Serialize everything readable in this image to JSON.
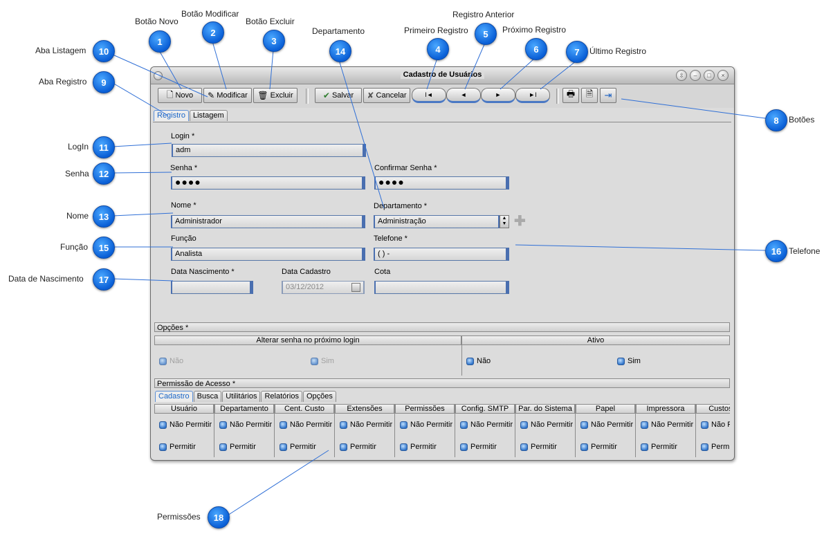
{
  "window": {
    "title": "Cadastro de Usuários"
  },
  "toolbar": {
    "novo": "Novo",
    "modificar": "Modificar",
    "excluir": "Excluir",
    "salvar": "Salvar",
    "cancelar": "Cancelar",
    "nav_first": "I◄",
    "nav_prev": "◄",
    "nav_next": "►",
    "nav_last": "►I"
  },
  "tabs": {
    "registro": "Registro",
    "listagem": "Listagem"
  },
  "form": {
    "login_label": "Login *",
    "login_value": "adm",
    "senha_label": "Senha *",
    "senha_value": "●●●●",
    "confirmar_label": "Confirmar Senha *",
    "confirmar_value": "●●●●",
    "nome_label": "Nome *",
    "nome_value": "Administrador",
    "departamento_label": "Departamento *",
    "departamento_value": "Administração",
    "funcao_label": "Função",
    "funcao_value": "Analista",
    "telefone_label": "Telefone *",
    "telefone_value": "(  )     -",
    "nascimento_label": "Data Nascimento *",
    "nascimento_value": "",
    "cadastro_label": "Data Cadastro",
    "cadastro_value": "03/12/2012",
    "cota_label": "Cota",
    "cota_value": ""
  },
  "opcoes": {
    "title": "Opções *",
    "alterar_senha": "Alterar senha no próximo login",
    "ativo": "Ativo",
    "nao": "Não",
    "sim": "Sim"
  },
  "permissao": {
    "title": "Permissão de Acesso *",
    "tabs": [
      "Cadastro",
      "Busca",
      "Utilitários",
      "Relatórios",
      "Opções"
    ],
    "columns": [
      "Usuário",
      "Departamento",
      "Cent. Custo",
      "Extensões",
      "Permissões",
      "Config. SMTP",
      "Par. do Sistema",
      "Papel",
      "Impressora",
      "Custos de"
    ],
    "nao_permitir": "Não Permitir",
    "permitir": "Permitir"
  },
  "callouts": {
    "c1": "Botão Novo",
    "c2": "Botão Modificar",
    "c3": "Botão Excluir",
    "c4": "Primeiro Registro",
    "c5": "Registro Anterior",
    "c6": "Próximo Registro",
    "c7": "Último Registro",
    "c8": "Botões",
    "c9": "Aba Registro",
    "c10": "Aba Listagem",
    "c11": "LogIn",
    "c12": "Senha",
    "c13": "Nome",
    "c14": "Departamento",
    "c15": "Função",
    "c16": "Telefone",
    "c17": "Data de Nascimento",
    "c18": "Permissões"
  },
  "badges": [
    "1",
    "2",
    "3",
    "4",
    "5",
    "6",
    "7",
    "8",
    "9",
    "10",
    "11",
    "12",
    "13",
    "14",
    "15",
    "16",
    "17",
    "18"
  ]
}
